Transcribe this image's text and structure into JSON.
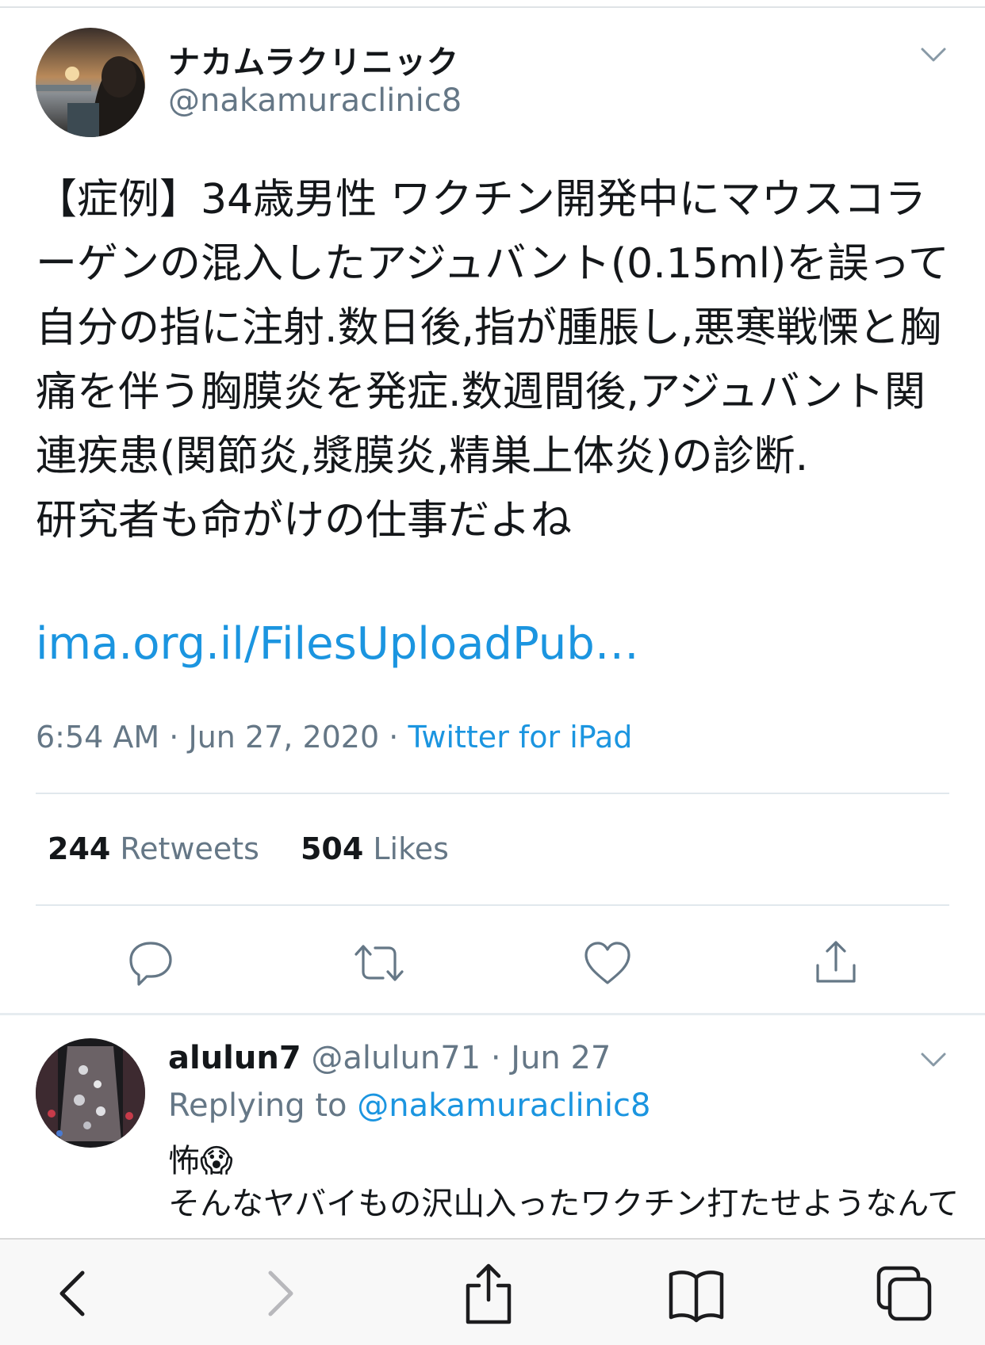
{
  "tweet": {
    "display_name": "ナカムラクリニック",
    "handle": "@nakamuraclinic8",
    "body": "【症例】34歳男性 ワクチン開発中にマウスコラーゲンの混入したアジュバント(0.15ml)を誤って自分の指に注射.数日後,指が腫脹し,悪寒戦慄と胸痛を伴う胸膜炎を発症.数週間後,アジュバント関連疾患(関節炎,漿膜炎,精巣上体炎)の診断.\n研究者も命がけの仕事だよね",
    "link_text": "ima.org.il/FilesUploadPub…",
    "time": "6:54 AM",
    "date": "Jun 27, 2020",
    "separator": "·",
    "source": "Twitter for iPad",
    "retweets_count": "244",
    "retweets_label": "Retweets",
    "likes_count": "504",
    "likes_label": "Likes",
    "actions": [
      "reply-icon",
      "retweet-icon",
      "like-icon",
      "share-icon"
    ]
  },
  "reply": {
    "display_name": "alulun7",
    "handle": "@alulun71",
    "separator": "·",
    "date": "Jun 27",
    "replying_label": "Replying to",
    "replying_to": "@nakamuraclinic8",
    "line1": "怖😱",
    "line2": "そんなヤバイもの沢山入ったワクチン打たせようなんて"
  },
  "browser_toolbar": {
    "items": [
      "back-icon",
      "forward-icon",
      "share-icon",
      "bookmarks-icon",
      "tabs-icon"
    ]
  },
  "colors": {
    "link": "#1b95e0",
    "secondary_text": "#657786",
    "primary_text": "#14171a",
    "divider": "#e1e8ed"
  }
}
